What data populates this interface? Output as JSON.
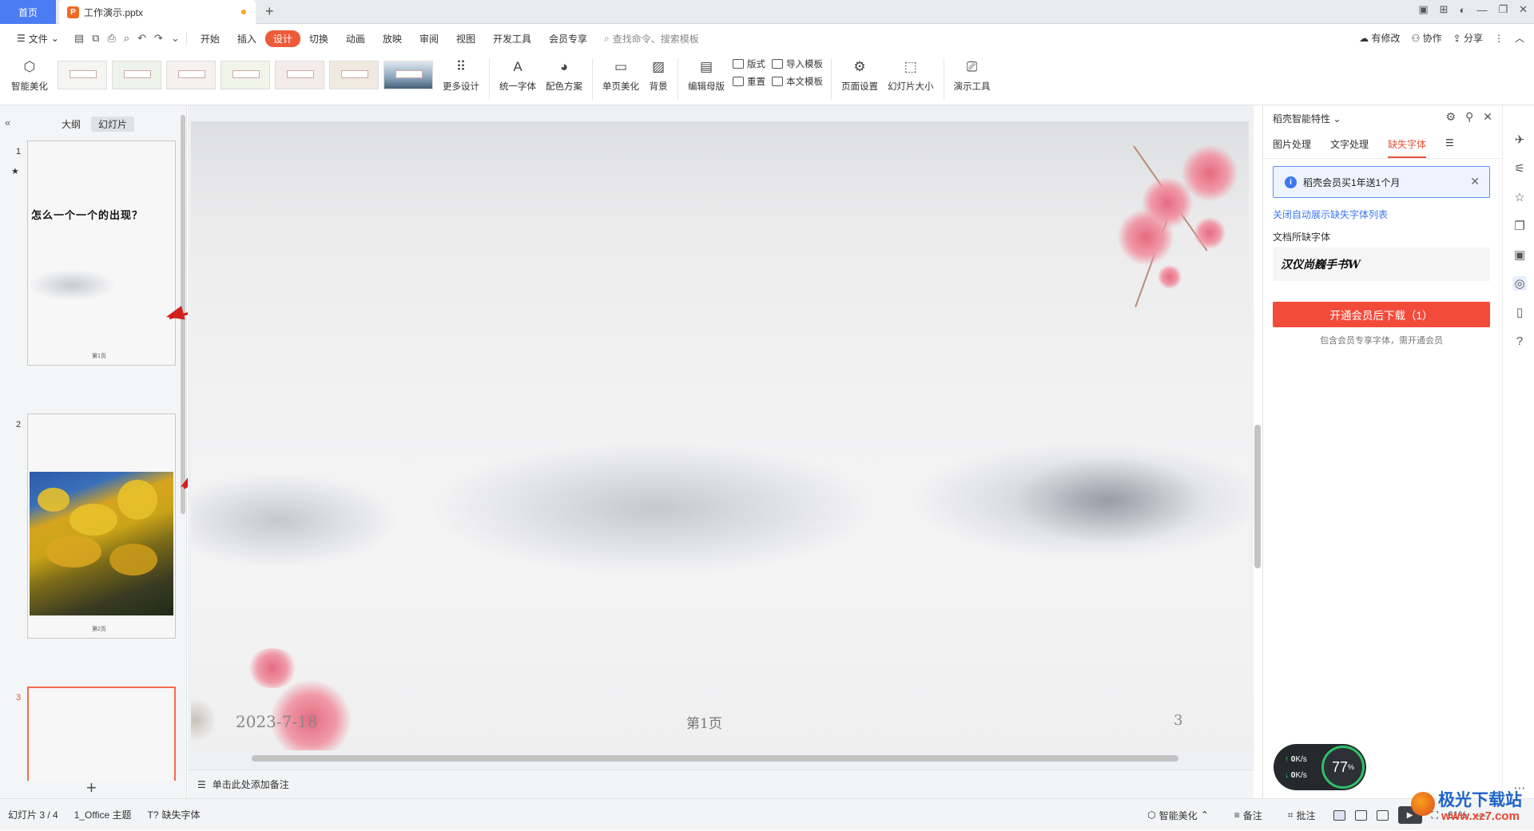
{
  "tabs": {
    "home": "首页",
    "doc_title": "工作演示.pptx",
    "add": "+"
  },
  "menubar": {
    "file": "文件",
    "items": [
      "开始",
      "插入",
      "设计",
      "切换",
      "动画",
      "放映",
      "审阅",
      "视图",
      "开发工具",
      "会员专享"
    ],
    "active": "设计",
    "search_placeholder": "查找命令、搜索模板",
    "right": [
      "有修改",
      "协作",
      "分享"
    ]
  },
  "ribbon": {
    "smart": "智能美化",
    "more_design": "更多设计",
    "unify_font": "统一字体",
    "color_scheme": "配色方案",
    "single_beautify": "单页美化",
    "background": "背景",
    "edit_master": "编辑母版",
    "layout": "版式",
    "reset": "重置",
    "import_template": "导入模板",
    "text_template": "本文模板",
    "page_setup": "页面设置",
    "slide_size": "幻灯片大小",
    "present_tools": "演示工具"
  },
  "left_panel": {
    "tab_outline": "大纲",
    "tab_slides": "幻灯片",
    "slides": [
      {
        "num": "1",
        "title": "怎么一个一个的出现？",
        "footer": "第1页"
      },
      {
        "num": "2",
        "footer": "第2页"
      },
      {
        "num": "3"
      }
    ],
    "add": "+"
  },
  "main_slide": {
    "date": "2023-7-18",
    "page": "第1页",
    "number": "3"
  },
  "notes": {
    "placeholder": "单击此处添加备注"
  },
  "right_panel": {
    "title": "稻壳智能特性",
    "tabs": [
      "图片处理",
      "文字处理",
      "缺失字体"
    ],
    "active_tab": "缺失字体",
    "banner": "稻壳会员买1年送1个月",
    "link": "关闭自动展示缺失字体列表",
    "label": "文档所缺字体",
    "missing_font": "汉仪尚巍手书W",
    "button": "开通会员后下载（1）",
    "note": "包含会员专享字体，需开通会员"
  },
  "network": {
    "up": "0",
    "down": "0",
    "unit": "K/s",
    "percent": "77",
    "percent_unit": "%"
  },
  "statusbar": {
    "slide_info": "幻灯片 3 / 4",
    "theme": "1_Office 主题",
    "missing_font": "缺失字体",
    "smart": "智能美化",
    "notes": "备注",
    "comment": "批注",
    "zoom": "61%"
  },
  "watermark": {
    "name": "极光下载站",
    "url": "www.xz7.com"
  },
  "colors": {
    "accent": "#ee5b3a",
    "home_tab": "#4b7cf4",
    "arrow": "#d41f1f",
    "download_button": "#f24b3a"
  }
}
